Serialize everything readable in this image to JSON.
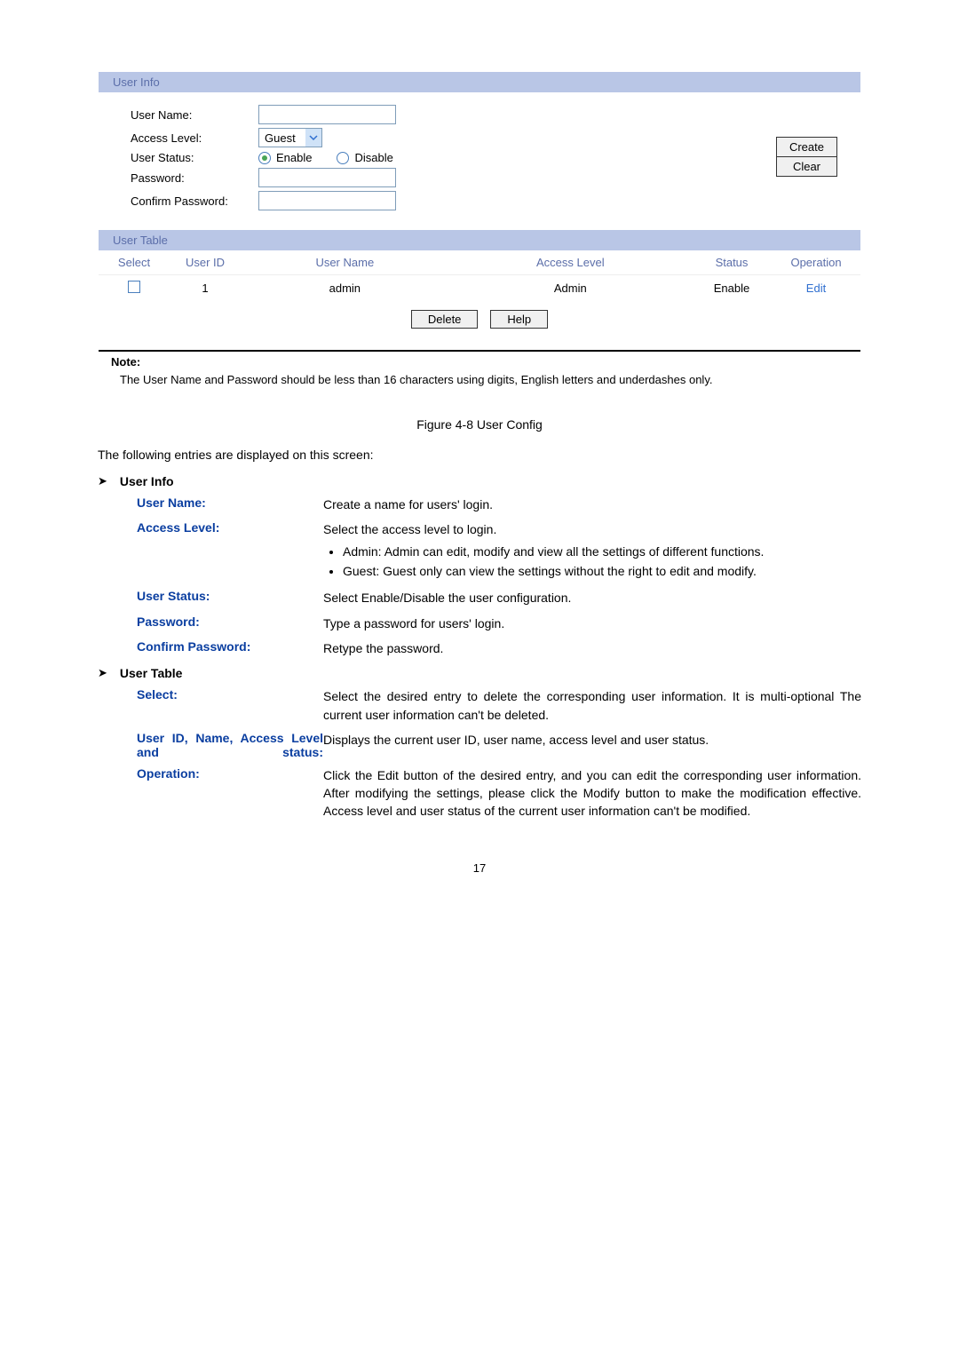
{
  "userInfo": {
    "header": "User Info",
    "labels": {
      "userName": "User Name:",
      "accessLevel": "Access Level:",
      "userStatus": "User Status:",
      "password": "Password:",
      "confirmPassword": "Confirm Password:"
    },
    "accessLevelValue": "Guest",
    "statusEnable": "Enable",
    "statusDisable": "Disable",
    "buttons": {
      "create": "Create",
      "clear": "Clear"
    }
  },
  "userTable": {
    "header": "User Table",
    "cols": {
      "select": "Select",
      "userId": "User ID",
      "userName": "User Name",
      "accessLevel": "Access Level",
      "status": "Status",
      "operation": "Operation"
    },
    "rows": [
      {
        "userId": "1",
        "userName": "admin",
        "accessLevel": "Admin",
        "status": "Enable",
        "operation": "Edit"
      }
    ],
    "buttons": {
      "delete": "Delete",
      "help": "Help"
    }
  },
  "note": {
    "label": "Note:",
    "text": "The User Name and Password should be less than 16 characters using digits, English letters and underdashes only."
  },
  "caption": "Figure 4-8 User Config",
  "introLine": "The following entries are displayed on this screen:",
  "sections": {
    "userInfoTitle": "User Info",
    "userTableTitle": "User Table"
  },
  "defs": {
    "userName": {
      "term": "User Name:",
      "desc": "Create a name for users' login."
    },
    "accessLevel": {
      "term": "Access Level:",
      "intro": "Select the access level to login.",
      "b1": "Admin: Admin can edit, modify and view all the settings of different functions.",
      "b2": "Guest: Guest only can view the settings without the right to edit and modify."
    },
    "userStatus": {
      "term": "User Status:",
      "desc": "Select Enable/Disable the user configuration."
    },
    "password": {
      "term": "Password:",
      "desc": "Type a password for users' login."
    },
    "confirmPassword": {
      "term": "Confirm Password:",
      "desc": "Retype the password."
    },
    "select": {
      "term": "Select:",
      "desc": "Select the desired entry to delete the corresponding user information. It is multi-optional The current user information can't be deleted."
    },
    "combined": {
      "term": "User ID, Name, Access Level and status:",
      "desc": "Displays the current user ID, user name, access level and user status."
    },
    "operation": {
      "term": "Operation:",
      "desc": "Click the Edit button of the desired entry, and you can edit the corresponding user information. After modifying the settings, please click the Modify button to make the modification effective. Access level and user status of the current user information can't be modified."
    }
  },
  "pageNumber": "17"
}
